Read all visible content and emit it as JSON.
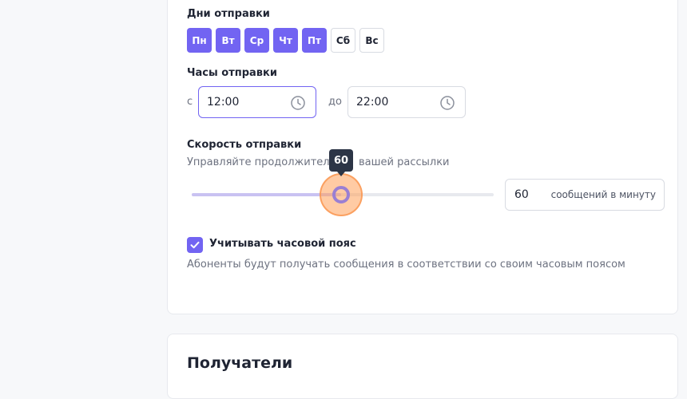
{
  "send_days": {
    "label": "Дни отправки",
    "days": [
      {
        "label": "Пн",
        "selected": true
      },
      {
        "label": "Вт",
        "selected": true
      },
      {
        "label": "Ср",
        "selected": true
      },
      {
        "label": "Чт",
        "selected": true
      },
      {
        "label": "Пт",
        "selected": true
      },
      {
        "label": "Сб",
        "selected": false
      },
      {
        "label": "Вс",
        "selected": false
      }
    ]
  },
  "send_hours": {
    "label": "Часы отправки",
    "from_label": "с",
    "from_value": "12:00",
    "to_label": "до",
    "to_value": "22:00"
  },
  "send_speed": {
    "label": "Скорость отправки",
    "description_left": "Управляйте продолжительно",
    "description_right": "вашей рассылки",
    "value": 60,
    "value_text": "60",
    "slider_fraction": 0.5,
    "unit": "сообщений в минуту"
  },
  "timezone": {
    "label": "Учитывать часовой пояс",
    "checked": true,
    "description": "Абоненты будут получать сообщения в соответствии со своим часовым поясом"
  },
  "recipients": {
    "title": "Получатели"
  },
  "colors": {
    "accent": "#7264f2",
    "slider_halo": "#ffa05a"
  },
  "icons": {
    "clock": "clock-icon",
    "check": "check-icon"
  }
}
